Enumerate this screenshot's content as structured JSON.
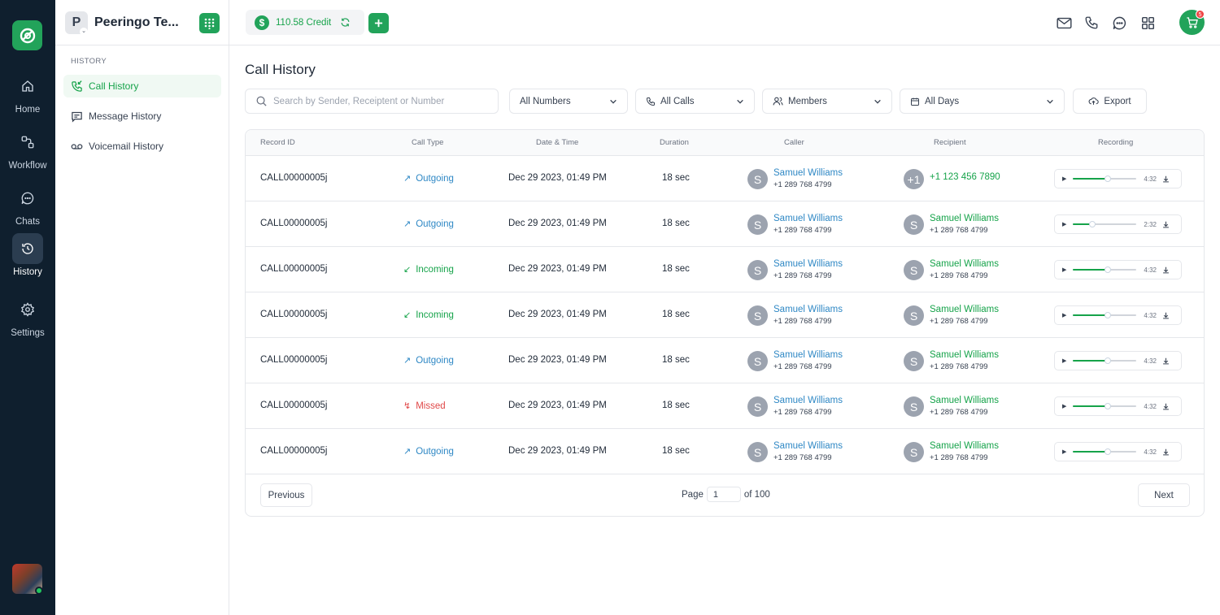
{
  "rail": {
    "items": [
      {
        "label": "Home",
        "icon": "home-icon"
      },
      {
        "label": "Workflow",
        "icon": "workflow-icon"
      },
      {
        "label": "Chats",
        "icon": "chat-icon"
      },
      {
        "label": "History",
        "icon": "history-icon",
        "active": true
      },
      {
        "label": "Settings",
        "icon": "gear-icon"
      }
    ]
  },
  "workspace": {
    "initial": "P",
    "name": "Peeringo Te..."
  },
  "sidebar": {
    "section": "HISTORY",
    "items": [
      {
        "label": "Call History",
        "active": true
      },
      {
        "label": "Message History"
      },
      {
        "label": "Voicemail History"
      }
    ]
  },
  "topbar": {
    "credit": "110.58 Credit",
    "cart_count": "5"
  },
  "page": {
    "title": "Call History"
  },
  "filters": {
    "search_placeholder": "Search by Sender, Receiptent or Number",
    "numbers": "All Numbers",
    "calls": "All Calls",
    "members": "Members",
    "days": "All Days",
    "export": "Export"
  },
  "table": {
    "columns": [
      "Record ID",
      "Call Type",
      "Date & Time",
      "Duration",
      "Caller",
      "Recipient",
      "Recording"
    ],
    "rows": [
      {
        "id": "CALL00000005j",
        "type": "Outgoing",
        "kind": "outgoing",
        "datetime": "Dec 29 2023, 01:49 PM",
        "duration": "18 sec",
        "caller_initial": "S",
        "caller_name": "Samuel Williams",
        "caller_number": "+1 289 768 4799",
        "recipient_initial": "+1",
        "recipient_name": "",
        "recipient_number": "+1 123 456 7890",
        "rec_time": "4:32",
        "progress": 0.55
      },
      {
        "id": "CALL00000005j",
        "type": "Outgoing",
        "kind": "outgoing",
        "datetime": "Dec 29 2023, 01:49 PM",
        "duration": "18 sec",
        "caller_initial": "S",
        "caller_name": "Samuel Williams",
        "caller_number": "+1 289 768 4799",
        "recipient_initial": "S",
        "recipient_name": "Samuel Williams",
        "recipient_number": "+1 289 768 4799",
        "rec_time": "2:32",
        "progress": 0.3
      },
      {
        "id": "CALL00000005j",
        "type": "Incoming",
        "kind": "incoming",
        "datetime": "Dec 29 2023, 01:49 PM",
        "duration": "18 sec",
        "caller_initial": "S",
        "caller_name": "Samuel Williams",
        "caller_number": "+1 289 768 4799",
        "recipient_initial": "S",
        "recipient_name": "Samuel Williams",
        "recipient_number": "+1 289 768 4799",
        "rec_time": "4:32",
        "progress": 0.55
      },
      {
        "id": "CALL00000005j",
        "type": "Incoming",
        "kind": "incoming",
        "datetime": "Dec 29 2023, 01:49 PM",
        "duration": "18 sec",
        "caller_initial": "S",
        "caller_name": "Samuel Williams",
        "caller_number": "+1 289 768 4799",
        "recipient_initial": "S",
        "recipient_name": "Samuel Williams",
        "recipient_number": "+1 289 768 4799",
        "rec_time": "4:32",
        "progress": 0.55
      },
      {
        "id": "CALL00000005j",
        "type": "Outgoing",
        "kind": "outgoing",
        "datetime": "Dec 29 2023, 01:49 PM",
        "duration": "18 sec",
        "caller_initial": "S",
        "caller_name": "Samuel Williams",
        "caller_number": "+1 289 768 4799",
        "recipient_initial": "S",
        "recipient_name": "Samuel Williams",
        "recipient_number": "+1 289 768 4799",
        "rec_time": "4:32",
        "progress": 0.55
      },
      {
        "id": "CALL00000005j",
        "type": "Missed",
        "kind": "missed",
        "datetime": "Dec 29 2023, 01:49 PM",
        "duration": "18 sec",
        "caller_initial": "S",
        "caller_name": "Samuel Williams",
        "caller_number": "+1 289 768 4799",
        "recipient_initial": "S",
        "recipient_name": "Samuel Williams",
        "recipient_number": "+1 289 768 4799",
        "rec_time": "4:32",
        "progress": 0.55
      },
      {
        "id": "CALL00000005j",
        "type": "Outgoing",
        "kind": "outgoing",
        "datetime": "Dec 29 2023, 01:49 PM",
        "duration": "18 sec",
        "caller_initial": "S",
        "caller_name": "Samuel Williams",
        "caller_number": "+1 289 768 4799",
        "recipient_initial": "S",
        "recipient_name": "Samuel Williams",
        "recipient_number": "+1 289 768 4799",
        "rec_time": "4:32",
        "progress": 0.55
      }
    ]
  },
  "pagination": {
    "previous": "Previous",
    "page_label": "Page",
    "page": "1",
    "of_label": "of 100",
    "next": "Next"
  },
  "colors": {
    "brand": "#22a35a",
    "rail": "#0f1f2e",
    "link": "#2f88c5",
    "missed": "#e04848"
  }
}
